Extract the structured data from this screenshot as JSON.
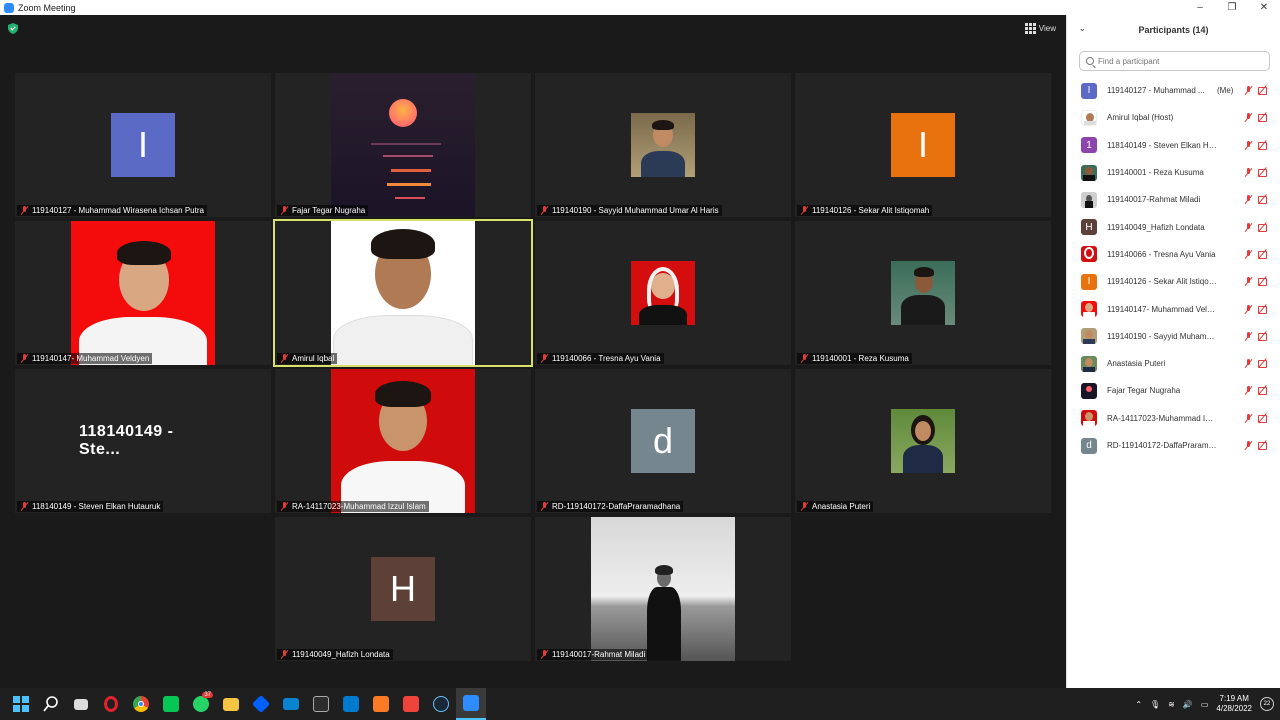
{
  "window": {
    "title": "Zoom Meeting",
    "minimize": "–",
    "restore": "❐",
    "close": "✕"
  },
  "toolbar": {
    "view_label": "View"
  },
  "tiles": [
    {
      "name": "119140127 - Muhammad Wirasena Ichsan Putra"
    },
    {
      "name": "Fajar Tegar Nugraha"
    },
    {
      "name": "119140190 - Sayyid Muhammad Umar Al Haris"
    },
    {
      "name": "119140126 - Sekar Alit Istiqomah"
    },
    {
      "name": "119140147- Muhammad Veldyen"
    },
    {
      "name": "Amirul Iqbal"
    },
    {
      "name": "119140066 - Tresna Ayu Vania"
    },
    {
      "name": "119140001 - Reza Kusuma"
    },
    {
      "name": "118140149 - Steven Elkan Hutauruk",
      "display_name": "118140149 - Ste..."
    },
    {
      "name": "RA-14117023-Muhammad Izzul Islam"
    },
    {
      "name": "RD-119140172-DaffaPraramadhana"
    },
    {
      "name": "Anastasia Puteri"
    },
    {
      "name": "119140049_Hafizh Londata"
    },
    {
      "name": "119140017-Rahmat Miladi"
    }
  ],
  "avatars": {
    "i_letter": "I",
    "d_letter": "d",
    "h_letter": "H",
    "one_letter": "1"
  },
  "colors": {
    "i_blue": "#5b6bc5",
    "i_orange": "#e8730e",
    "d_gray": "#75868f",
    "h_brown": "#5d4037",
    "purple": "#8e44ad",
    "active_border": "#d8e26b",
    "mute_red": "#e23b3b"
  },
  "participants_panel": {
    "title": "Participants (14)",
    "search_placeholder": "Find a participant",
    "items": [
      {
        "name": "119140127 - Muhammad ...",
        "tag": "(Me)"
      },
      {
        "name": "Amirul Iqbal (Host)"
      },
      {
        "name": "118140149 - Steven Elkan Hutau..."
      },
      {
        "name": "119140001 - Reza Kusuma"
      },
      {
        "name": "119140017-Rahmat Miladi"
      },
      {
        "name": "119140049_Hafizh Londata"
      },
      {
        "name": "119140066 - Tresna Ayu Vania"
      },
      {
        "name": "119140126 - Sekar Alit Istiqomah"
      },
      {
        "name": "119140147- Muhammad Veldyen"
      },
      {
        "name": "119140190 - Sayyid Muhammad..."
      },
      {
        "name": "Anastasia Puteri"
      },
      {
        "name": "Fajar Tegar Nugraha"
      },
      {
        "name": "RA-14117023-Muhammad Izzul I..."
      },
      {
        "name": "RD-119140172-DaffaPraramadh..."
      }
    ]
  },
  "taskbar": {
    "whatsapp_badge": "37",
    "time": "7:19 AM",
    "date": "4/28/2022",
    "notifications": "22"
  }
}
